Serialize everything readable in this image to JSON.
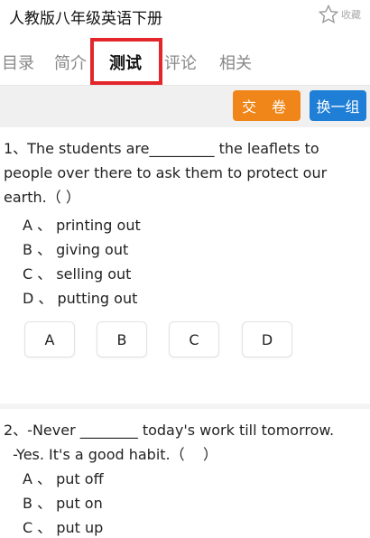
{
  "header": {
    "title": "人教版八年级英语下册",
    "favorite_label": "收藏"
  },
  "tabs": [
    {
      "label": "目录",
      "active": false
    },
    {
      "label": "简介",
      "active": false
    },
    {
      "label": "测试",
      "active": true
    },
    {
      "label": "评论",
      "active": false
    },
    {
      "label": "相关",
      "active": false
    }
  ],
  "actions": {
    "submit_label": "交 卷",
    "next_label": "换一组"
  },
  "questions": [
    {
      "text": "1、The students are_________ the leaflets to people over there to ask them to protect our earth.（    ）",
      "options": [
        "A 、 printing out",
        "B 、 giving out",
        "C 、 selling out",
        "D 、 putting out"
      ],
      "answer_buttons": [
        "A",
        "B",
        "C",
        "D"
      ]
    },
    {
      "text": "2、-Never ________ today's work till tomorrow.\n  -Yes. It's a good habit.（    ）",
      "options": [
        "A 、 put off",
        "B 、 put on",
        "C 、 put up"
      ]
    }
  ],
  "colors": {
    "submit": "#f08519",
    "next": "#1f7fd6",
    "highlight": "#e3262b"
  }
}
